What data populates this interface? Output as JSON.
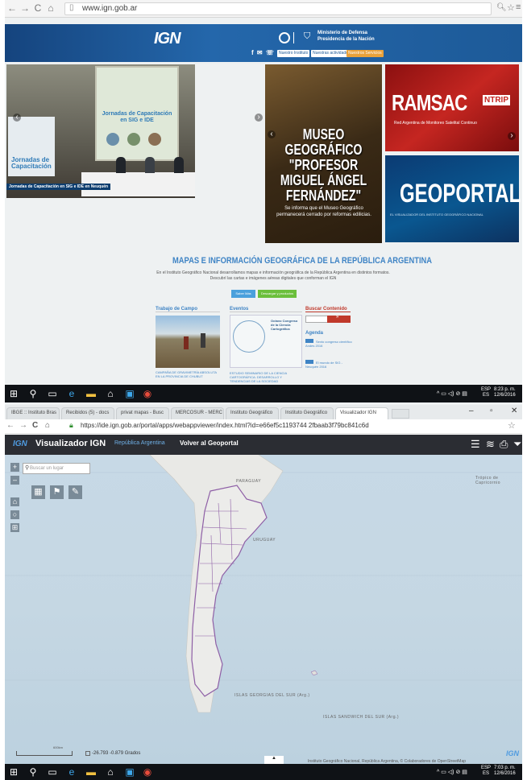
{
  "top_browser": {
    "url": "www.ign.gob.ar"
  },
  "ign_site": {
    "logo": "IGN",
    "ministry_line1": "Ministerio de Defensa",
    "ministry_line2": "Presidencia de la Nación",
    "social": "f ✉ ☏ ✆",
    "header_buttons": [
      {
        "label": "Nuestro Instituto",
        "color": "#ffffff"
      },
      {
        "label": "Nuestras actividades",
        "color": "#ffffff"
      },
      {
        "label": "Nuestros Servicios",
        "color": "#e8a13a"
      }
    ],
    "slide_left": {
      "screen_title": "Jornadas de Capacitación en SIG e IDE",
      "banner": "Jornadas de Capacitación",
      "caption": "Jornadas de Capacitación en SIG e IDE en Neuquén"
    },
    "museo": {
      "title": "MUSEO GEOGRÁFICO \"PROFESOR MIGUEL ÁNGEL FERNÁNDEZ\"",
      "subtitle": "Se informa que el Museo Geográfico permanecerá cerrado por reformas edilicias."
    },
    "ramsac": {
      "title": "RAMSAC",
      "badge": "NTRIP",
      "subtitle": "Red Argentina de Monitoreo Satelital Continuo"
    },
    "geoportal": {
      "title": "GEOPORTAL",
      "subtitle": "EL VISUALIZADOR DEL INSTITUTO GEOGRÁFICO NACIONAL"
    },
    "maps_title": "MAPAS E INFORMACIÓN GEOGRÁFICA DE LA REPÚBLICA ARGENTINA",
    "maps_desc": "En el Instituto Geográfico Nacional desarrollamos mapas e información geográfica de la República Argentina en distintos formatos. Descubrí las cartas e imágenes aéreas digitales que conforman el IGN",
    "btn_blue": "Saber Más",
    "btn_green": "Descargar y productos",
    "col_trabajo": "Trabajo de Campo",
    "trabajo_caption": "CAMPAÑA DE GRAVIMETRÍA ABSOLUTA EN LA PROVINCIA DE CHUBUT",
    "col_eventos": "Eventos",
    "evento_caption": "ESTUDIO SEMINARIO DE LA CIENCIA CARTOGRÁFICA: DESARROLLO Y TENDENCIAS DE LA SOCIEDAD",
    "evento_img_text": "Octavo Congreso de la Ciencia Cartográfica",
    "col_buscar": "Buscar Contenido",
    "agenda_title": "Agenda",
    "agenda_items": [
      {
        "text": "Sexto congreso científico Andes 2016"
      },
      {
        "text": "El mundo de SIG - Neuquén 2016"
      }
    ]
  },
  "taskbar_top": {
    "clock_time": "8:23 p. m.",
    "clock_date": "12/6/2016",
    "lang": "ESP",
    "lang2": "ES"
  },
  "bottom_browser": {
    "tabs": [
      {
        "label": "IBGE :: Instituto Bras"
      },
      {
        "label": "Recibidos (5) - docs"
      },
      {
        "label": "privat mapas - Busc"
      },
      {
        "label": "MERCOSUR - MERC"
      },
      {
        "label": "Instituto Geográfico"
      },
      {
        "label": "Instituto Geográfico"
      },
      {
        "label": "Visualizador IGN"
      }
    ],
    "url": "https://ide.ign.gob.ar/portal/apps/webappviewer/index.html?id=e66ef5c1193744 2fbaab3f79bc841c6d"
  },
  "visor": {
    "logo": "IGN",
    "title": "Visualizador IGN",
    "nav_rep": "República Argentina",
    "nav_volver": "Volver al Geoportal",
    "search_placeholder": "Buscar un lugar",
    "labels": {
      "paraguay": "PARAGUAY",
      "uruguay": "URUGUAY",
      "tropico": "Trópico de Capricornio",
      "georgias": "ISLAS GEORGIAS DEL SUR (Arg.)",
      "sandwich": "ISLAS SANDWICH DEL SUR (Arg.)"
    },
    "coords": "-26.793 -0.879 Grados",
    "scale": "600km",
    "attribution": "Instituto Geográfico Nacional, República Argentina, © Colaboradores de OpenStreetMap"
  },
  "taskbar_bottom": {
    "clock_time": "7:03 p. m.",
    "clock_date": "12/6/2016",
    "lang": "ESP",
    "lang2": "ES"
  }
}
